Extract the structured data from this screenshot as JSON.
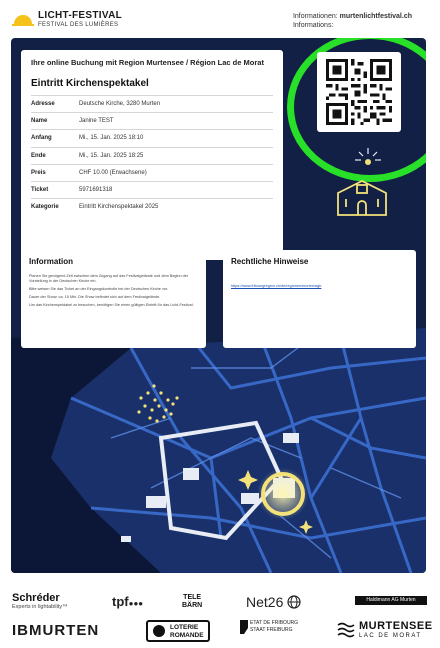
{
  "header": {
    "brand_name": "LICHT-FESTIVAL",
    "brand_sub": "FESTIVAL DES LUMIÈRES",
    "contact_line1_label": "Informationen:",
    "contact_line1_value": "murtenlichtfestival.ch",
    "contact_line2": "Informations:"
  },
  "booking": {
    "heading": "Ihre online Buchung mit Region Murtensee / Région Lac de Morat",
    "event": "Eintritt Kirchenspektakel",
    "rows": [
      {
        "label": "Adresse",
        "value": "Deutsche Kirche, 3280 Murten"
      },
      {
        "label": "Name",
        "value": "Janine TEST"
      },
      {
        "label": "Anfang",
        "value": "Mi., 15. Jan. 2025 18:10"
      },
      {
        "label": "Ende",
        "value": "Mi., 15. Jan. 2025 18:25"
      },
      {
        "label": "Preis",
        "value": "CHF 10.00 (Erwachsene)"
      },
      {
        "label": "Ticket",
        "value": "5971691318"
      },
      {
        "label": "Kategorie",
        "value": "Eintritt Kirchenspektakel 2025"
      }
    ]
  },
  "info_panel": {
    "title": "Information",
    "p1": "Planen Sie genügend Zeit zwischen dem Zugang auf das Festivalgelände und dem Beginn der Vorstellung in der Deutschen Kirche ein.",
    "p2": "Bitte weisen Sie das Ticket an der Eingangskontrolle bei der Deutschen Kirche vor.",
    "p3": "Dauer der Show: ca. 15 Min. Die Show befindet sich auf dem Festivalgelände.",
    "p4": "Um das Kirchenspektakel zu besuchen, benötigen Sie einen gültigen Eintritt für das Licht-Festival."
  },
  "legal_panel": {
    "title": "Rechtliche Hinweise",
    "link": "https://www.fribourgregion.ch/de/regionen/murten/agb"
  },
  "sponsors": {
    "schreder": "Schréder",
    "schreder_sub": "Experts in lightability™",
    "tpf": "tpf",
    "telebarn_1": "TELE",
    "telebarn_2": "BÄRN",
    "net26": "Net26",
    "haldimann": "Haldimann AG Murten",
    "ibmurten": "IBMURTEN",
    "loterie_1": "LOTERIE",
    "loterie_2": "ROMANDE",
    "fribourg_1": "ETAT DE FRIBOURG",
    "fribourg_2": "STAAT FREIBURG",
    "murtensee_1": "MURTENSEE",
    "murtensee_2": "LAC DE MORAT"
  },
  "colors": {
    "poster_bg": "#122046",
    "map_road": "#3b6fd0",
    "glow": "#f3e27a",
    "highlight_ring": "#28e028"
  }
}
